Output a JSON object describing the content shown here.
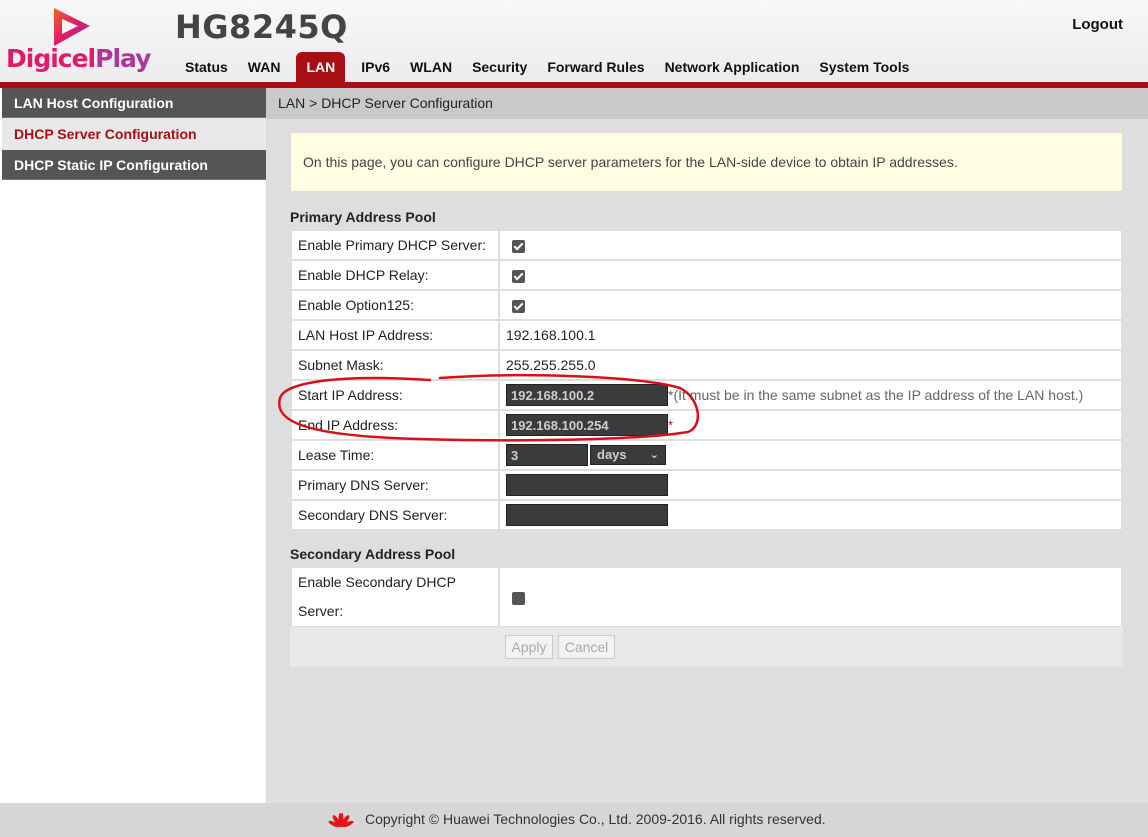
{
  "header": {
    "brand_part1": "Digicel",
    "brand_part2": "Play",
    "model": "HG8245Q",
    "logout": "Logout",
    "nav": [
      "Status",
      "WAN",
      "LAN",
      "IPv6",
      "WLAN",
      "Security",
      "Forward Rules",
      "Network Application",
      "System Tools"
    ],
    "active_nav": "LAN"
  },
  "sidebar": {
    "items": [
      {
        "label": "LAN Host Configuration"
      },
      {
        "label": "DHCP Server Configuration"
      },
      {
        "label": "DHCP Static IP Configuration"
      }
    ],
    "active": "DHCP Server Configuration"
  },
  "main": {
    "breadcrumb": "LAN > DHCP Server Configuration",
    "notice": "On this page, you can configure DHCP server parameters for the LAN-side device to obtain IP addresses.",
    "primary_pool": {
      "title": "Primary Address Pool",
      "enable_primary_label": "Enable Primary DHCP Server:",
      "enable_primary_checked": true,
      "enable_relay_label": "Enable DHCP Relay:",
      "enable_relay_checked": true,
      "enable_option125_label": "Enable Option125:",
      "enable_option125_checked": true,
      "lan_host_ip_label": "LAN Host IP Address:",
      "lan_host_ip_value": "192.168.100.1",
      "subnet_mask_label": "Subnet Mask:",
      "subnet_mask_value": "255.255.255.0",
      "start_ip_label": "Start IP Address:",
      "start_ip_value": "192.168.100.2",
      "start_ip_hint": "*(It must be in the same subnet as the IP address of the LAN host.)",
      "end_ip_label": "End IP Address:",
      "end_ip_value": "192.168.100.254",
      "required_mark": "*",
      "lease_time_label": "Lease Time:",
      "lease_time_value": "3",
      "lease_time_unit": "days",
      "primary_dns_label": "Primary DNS Server:",
      "primary_dns_value": "",
      "secondary_dns_label": "Secondary DNS Server:",
      "secondary_dns_value": ""
    },
    "secondary_pool": {
      "title": "Secondary Address Pool",
      "enable_secondary_label": "Enable Secondary DHCP Server:",
      "enable_secondary_checked": false
    },
    "buttons": {
      "apply": "Apply",
      "cancel": "Cancel"
    }
  },
  "footer": {
    "copyright": "Copyright © Huawei Technologies Co., Ltd. 2009-2016. All rights reserved."
  },
  "colors": {
    "accent": "#a80f14",
    "sidebar_dark": "#555555",
    "notice_bg": "#fffde2",
    "annotation": "#d8101a"
  }
}
